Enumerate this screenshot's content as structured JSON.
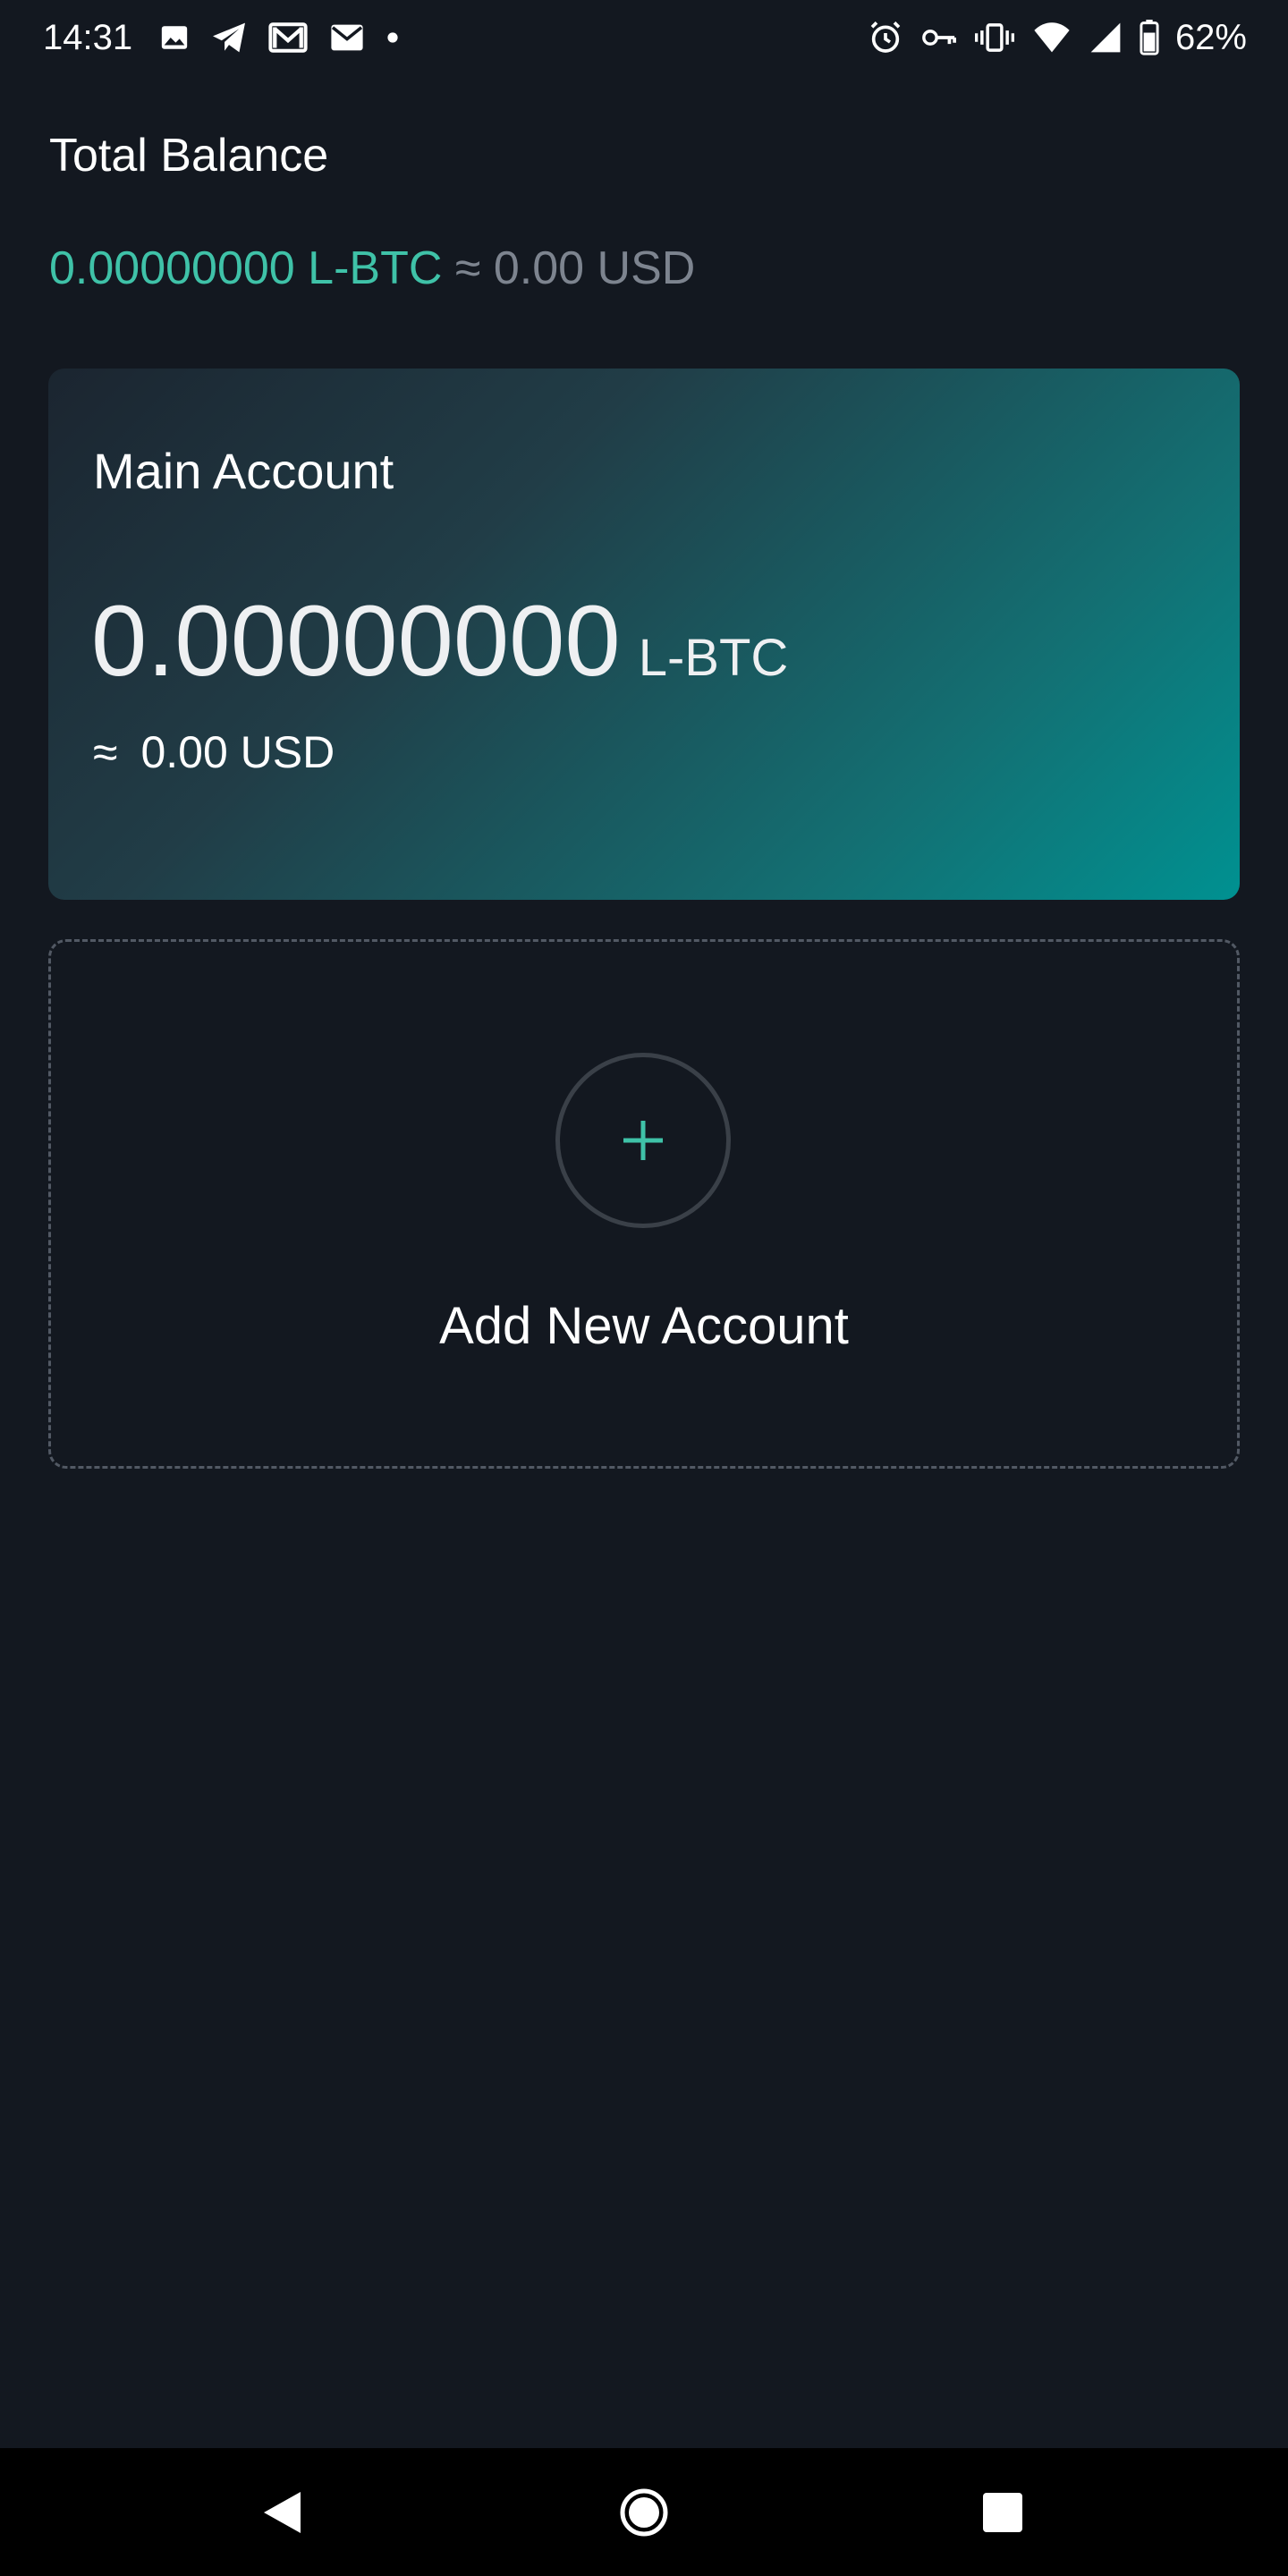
{
  "status_bar": {
    "time": "14:31",
    "battery_percent": "62%",
    "notification_icons": [
      "image-icon",
      "telegram-icon",
      "gmail-icon",
      "mail-icon",
      "dot-icon"
    ],
    "system_icons": [
      "alarm-icon",
      "vpn-key-icon",
      "vibrate-icon",
      "wifi-icon",
      "signal-icon",
      "battery-icon"
    ]
  },
  "total": {
    "label": "Total Balance",
    "btc_value": "0.00000000 L-BTC",
    "usd_value": "≈ 0.00 USD"
  },
  "account": {
    "name": "Main Account",
    "amount": "0.00000000",
    "unit": "L-BTC",
    "approx_symbol": "≈",
    "usd": "0.00 USD"
  },
  "add_account": {
    "label": "Add New Account",
    "icon": "plus-icon"
  },
  "colors": {
    "background": "#131820",
    "accent": "#3fc2a8",
    "muted": "#7d848f",
    "card_gradient_start": "#1b2530",
    "card_gradient_end": "#009191"
  },
  "nav": {
    "icons": [
      "back-icon",
      "home-icon",
      "recents-icon"
    ]
  }
}
